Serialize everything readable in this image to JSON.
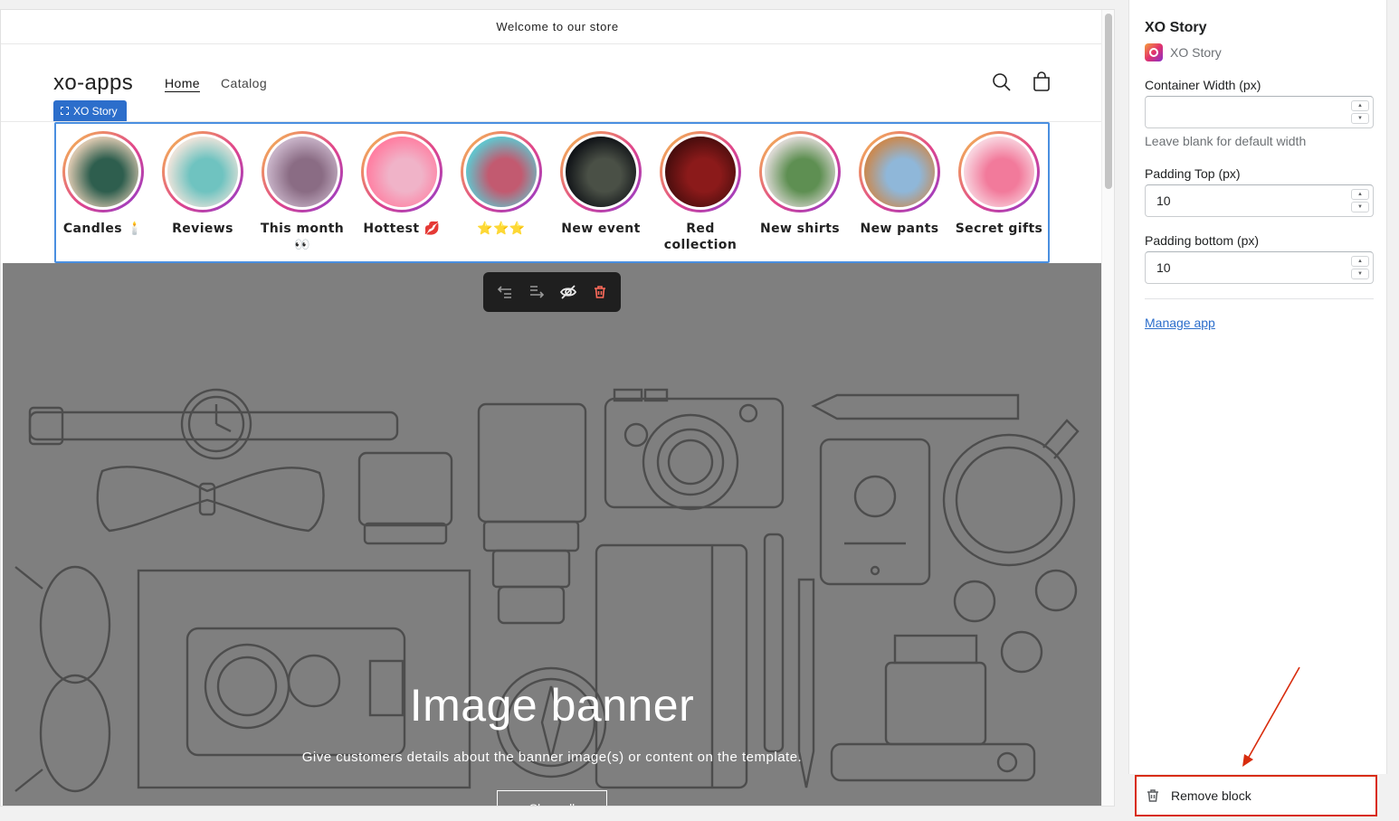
{
  "store": {
    "announcement": "Welcome to our store",
    "logo": "xo-apps",
    "nav": [
      {
        "label": "Home",
        "active": true
      },
      {
        "label": "Catalog",
        "active": false
      }
    ]
  },
  "block_tag": "XO Story",
  "stories": [
    {
      "label": "Candles 🕯️",
      "colors": [
        "#d8c6ae",
        "#2e5e4e"
      ]
    },
    {
      "label": "Reviews",
      "colors": [
        "#eae3da",
        "#6fc3c0"
      ]
    },
    {
      "label": "This month 👀",
      "colors": [
        "#c7b2c7",
        "#8a6c84"
      ]
    },
    {
      "label": "Hottest 💋",
      "colors": [
        "#ff7fa2",
        "#f0b3c8"
      ]
    },
    {
      "label": "⭐⭐⭐",
      "colors": [
        "#63c3cc",
        "#c25a70"
      ]
    },
    {
      "label": "New event",
      "colors": [
        "#111418",
        "#4a5046"
      ]
    },
    {
      "label": "Red collection",
      "colors": [
        "#4a0d0d",
        "#8b1a1a"
      ]
    },
    {
      "label": "New shirts",
      "colors": [
        "#dad8d2",
        "#5e8f52"
      ]
    },
    {
      "label": "New pants",
      "colors": [
        "#c98a53",
        "#8fb7d9"
      ]
    },
    {
      "label": "Secret gifts",
      "colors": [
        "#f8d3de",
        "#f27a9b"
      ]
    }
  ],
  "banner": {
    "title": "Image banner",
    "subtitle": "Give customers details about the banner image(s) or content on the template.",
    "button": "Shop all"
  },
  "panel": {
    "title": "XO Story",
    "app_name": "XO Story",
    "container_width_label": "Container Width (px)",
    "container_width_value": "",
    "container_width_help": "Leave blank for default width",
    "padding_top_label": "Padding Top (px)",
    "padding_top_value": "10",
    "padding_bottom_label": "Padding bottom (px)",
    "padding_bottom_value": "10",
    "manage_link": "Manage app",
    "remove_block": "Remove block"
  },
  "colors": {
    "accent": "#2c6ecb",
    "highlight": "#d82c0d",
    "banner_bg": "#7f7f7f"
  }
}
